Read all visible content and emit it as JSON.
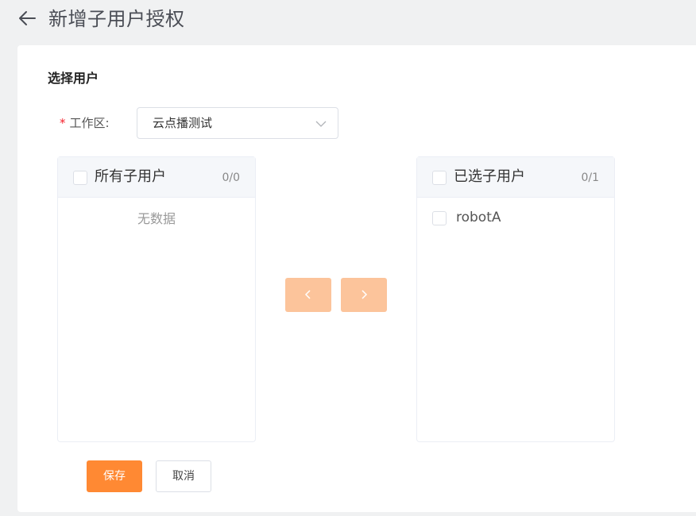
{
  "header": {
    "back_icon": "arrow-left-icon",
    "title": "新增子用户授权"
  },
  "form": {
    "section_title": "选择用户",
    "required_mark": "*",
    "workspace_label": "工作区:",
    "workspace_value": "云点播测试",
    "dropdown_icon": "chevron-down-icon"
  },
  "transfer": {
    "left": {
      "title": "所有子用户",
      "count": "0/0",
      "empty_text": "无数据",
      "items": []
    },
    "right": {
      "title": "已选子用户",
      "count": "0/1",
      "items": [
        {
          "label": "robotA",
          "checked": false
        }
      ]
    },
    "move_left_icon": "chevron-left-icon",
    "move_right_icon": "chevron-right-icon",
    "button_color": "#fcc49b"
  },
  "actions": {
    "save_label": "保存",
    "cancel_label": "取消",
    "accent_color": "#ff8933"
  }
}
